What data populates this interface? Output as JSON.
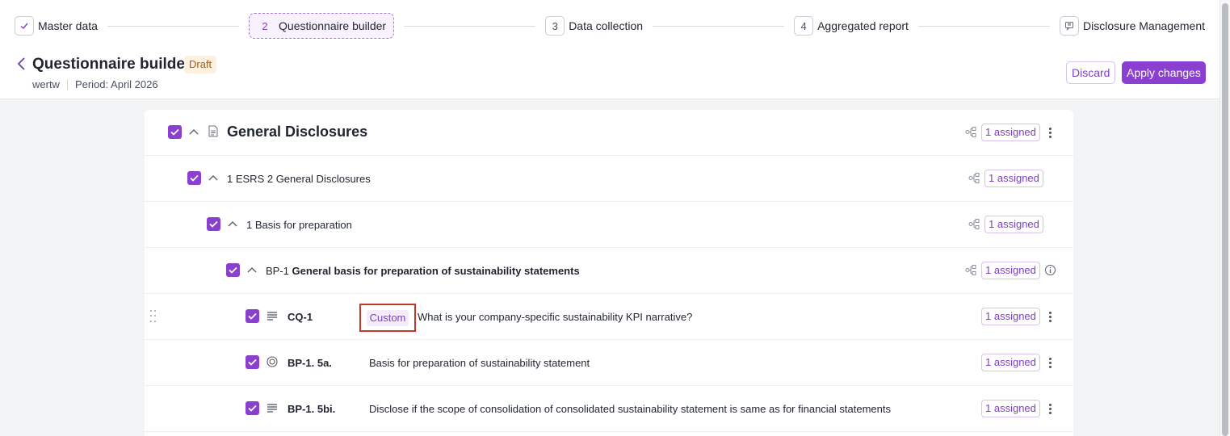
{
  "stepper": {
    "steps": [
      {
        "num": "",
        "label": "Master data",
        "state": "done"
      },
      {
        "num": "2",
        "label": "Questionnaire builder",
        "state": "active"
      },
      {
        "num": "3",
        "label": "Data collection",
        "state": "todo"
      },
      {
        "num": "4",
        "label": "Aggregated report",
        "state": "todo"
      },
      {
        "num": "",
        "label": "Disclosure Management",
        "state": "todo"
      }
    ]
  },
  "header": {
    "title": "Questionnaire builder",
    "status_badge": "Draft",
    "org": "wertw",
    "period": "Period: April 2026",
    "discard_label": "Discard",
    "apply_label": "Apply changes"
  },
  "colors": {
    "accent": "#8a3fd1",
    "highlight_box": "#c0392b"
  },
  "tree": {
    "section": {
      "title": "General Disclosures",
      "assigned": "1 assigned"
    },
    "standard": {
      "title": "1 ESRS 2 General Disclosures",
      "assigned": "1 assigned"
    },
    "group": {
      "title": "1 Basis for preparation",
      "assigned": "1 assigned"
    },
    "disclosure": {
      "code": "BP-1",
      "title": "General basis for preparation of sustainability statements",
      "assigned": "1 assigned"
    },
    "questions": [
      {
        "code": "CQ-1",
        "badge": "Custom",
        "text": "What is your company-specific sustainability KPI narrative?",
        "assigned": "1 assigned",
        "icon": "text-lines-icon"
      },
      {
        "code": "BP-1. 5a.",
        "text": "Basis for preparation of sustainability statement",
        "assigned": "1 assigned",
        "icon": "radio-target-icon"
      },
      {
        "code": "BP-1. 5bi.",
        "text": "Disclose if the scope of consolidation of consolidated sustainability statement is same as for financial statements",
        "assigned": "1 assigned",
        "icon": "text-lines-icon"
      }
    ]
  }
}
